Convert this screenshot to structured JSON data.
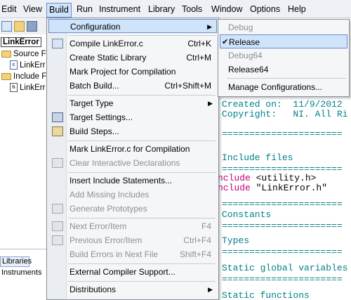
{
  "menubar": {
    "items": [
      "Edit",
      "View",
      "Build",
      "Run",
      "Instrument",
      "Library",
      "Tools",
      "Window",
      "Options",
      "Help"
    ]
  },
  "tree": {
    "project": "LinkError",
    "source_folder": "Source Fil",
    "source_file": "LinkErr",
    "include_folder": "Include Fi",
    "include_file": "LinkErr"
  },
  "bottom_panel": {
    "tab": "Libraries",
    "item": "Instruments"
  },
  "build_menu": {
    "configuration": "Configuration",
    "compile": "Compile LinkError.c",
    "compile_sc": "Ctrl+K",
    "create_static": "Create Static Library",
    "create_static_sc": "Ctrl+M",
    "mark_project": "Mark Project for Compilation",
    "batch_build": "Batch Build...",
    "batch_build_sc": "Ctrl+Shift+M",
    "target_type": "Target Type",
    "target_settings": "Target Settings...",
    "build_steps": "Build Steps...",
    "mark_file": "Mark LinkError.c for Compilation",
    "clear_interactive": "Clear Interactive Declarations",
    "insert_include": "Insert Include Statements...",
    "add_missing": "Add Missing Includes",
    "generate_prototypes": "Generate Prototypes",
    "next_error": "Next Error/Item",
    "next_error_sc": "F4",
    "prev_error": "Previous Error/Item",
    "prev_error_sc": "Ctrl+F4",
    "build_errors": "Build Errors in Next File",
    "build_errors_sc": "Shift+F4",
    "external_compiler": "External Compiler Support...",
    "distributions": "Distributions"
  },
  "config_submenu": {
    "debug": "Debug",
    "release": "Release",
    "debug64": "Debug64",
    "release64": "Release64",
    "manage": "Manage Configurations..."
  },
  "editor": {
    "created_on": "Created on:  11/9/2012",
    "copyright": "Copyright:   NI. All Ri",
    "include_files": "Include files",
    "include1_kw": "nclude",
    "include1_val": " <utility.h>",
    "include2_kw": "nclude",
    "include2_val": " \"LinkError.h\"",
    "constants": "Constants",
    "types": "Types",
    "static_globals": "Static global variables",
    "static_functions": "Static functions",
    "rule": "======================"
  }
}
